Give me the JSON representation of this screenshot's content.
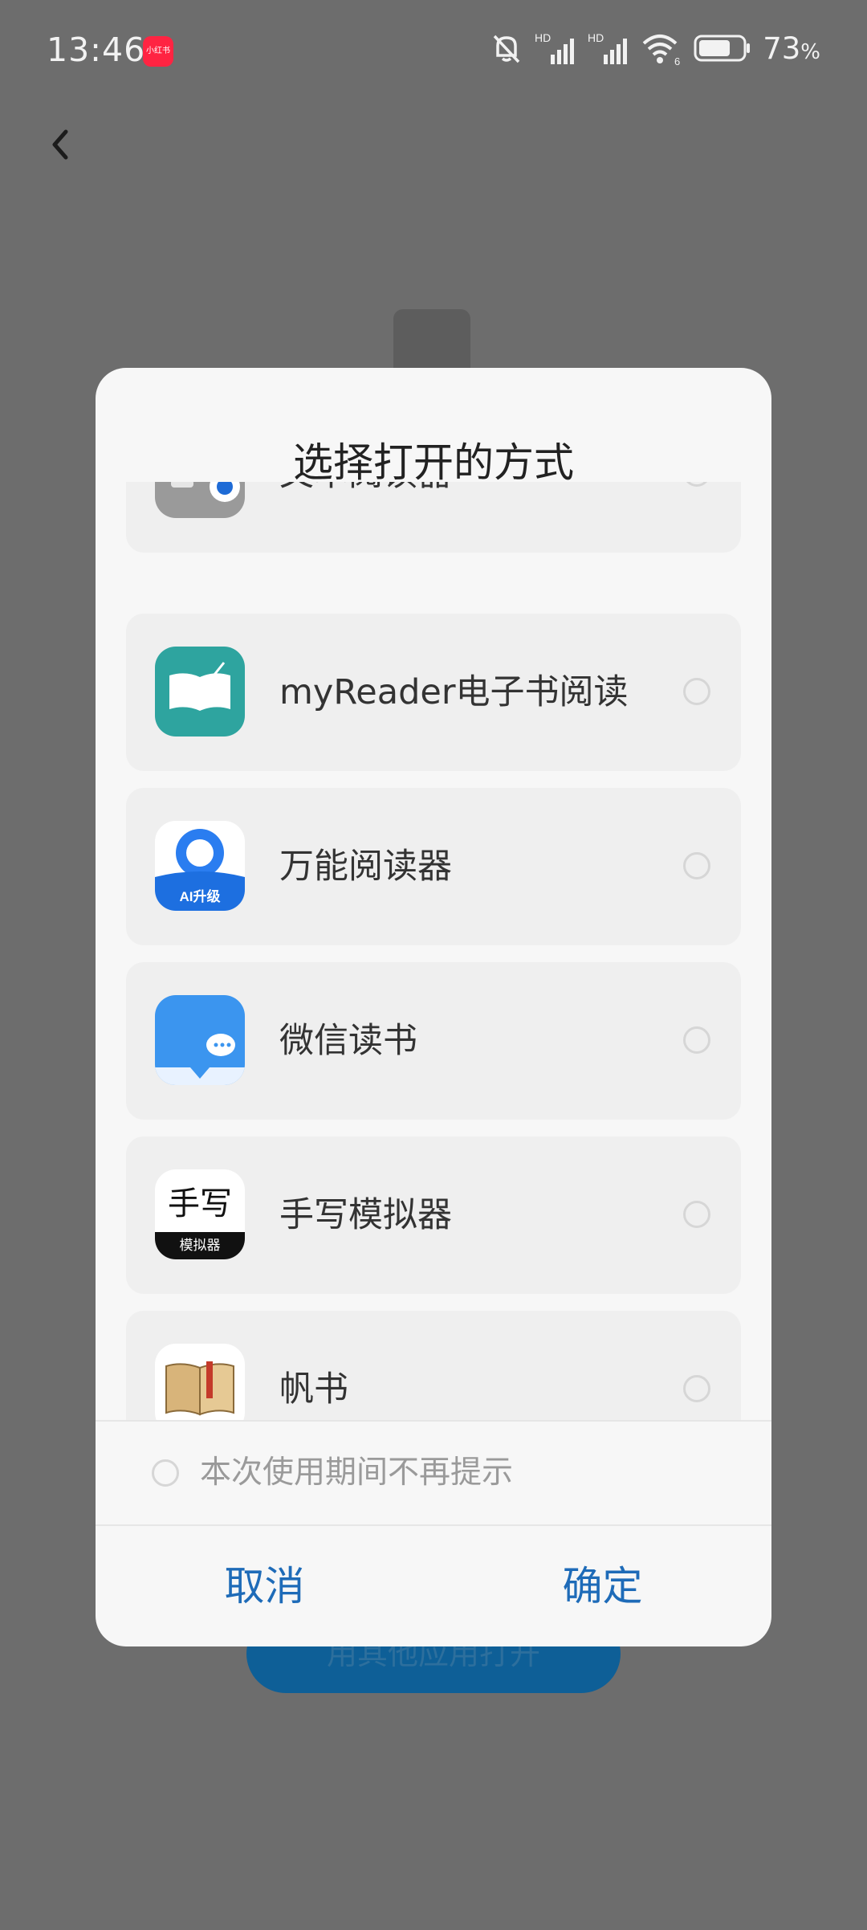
{
  "status_bar": {
    "time": "13:46",
    "app_badge": "小红书",
    "net1": "HD",
    "net2": "HD",
    "wifi_sub": "6",
    "battery_percent": "73",
    "battery_unit": "%",
    "battery_level": 0.73
  },
  "background": {
    "action_button": "用其他应用打开"
  },
  "dialog": {
    "title": "选择打开的方式",
    "items": [
      {
        "label": "文本阅读器",
        "icon": "text-reader-icon"
      },
      {
        "label": "myReader电子书阅读",
        "icon": "open-book-icon"
      },
      {
        "label": "万能阅读器",
        "icon": "universal-reader-icon",
        "badge": "AI升级"
      },
      {
        "label": "微信读书",
        "icon": "wechat-read-icon"
      },
      {
        "label": "手写模拟器",
        "icon": "handwriting-icon",
        "icon_text": "手写",
        "icon_subtext": "模拟器"
      },
      {
        "label": "帆书",
        "icon": "fanshu-book-icon"
      }
    ],
    "remember_label": "本次使用期间不再提示",
    "cancel": "取消",
    "confirm": "确定"
  },
  "colors": {
    "scrim": "#6d6d6d",
    "dialog_bg": "#f7f7f7",
    "accent": "#1e6bb8"
  }
}
